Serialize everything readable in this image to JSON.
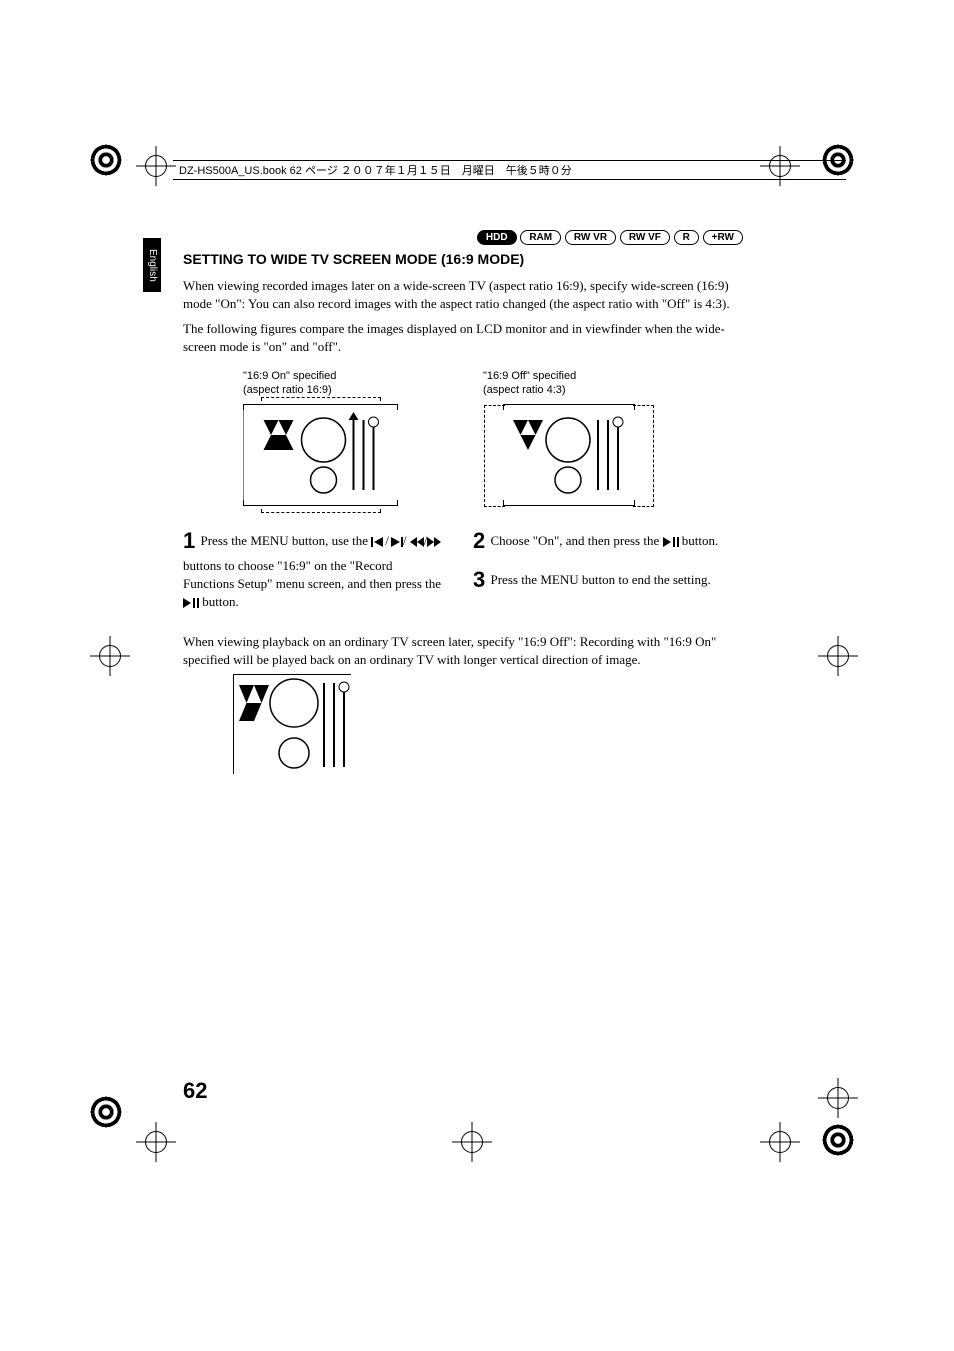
{
  "header_line": "DZ-HS500A_US.book  62 ページ  ２００７年１月１５日　月曜日　午後５時０分",
  "language_tab": "English",
  "badges": [
    "HDD",
    "RAM",
    "RW VR",
    "RW VF",
    "R",
    "+RW"
  ],
  "section_title": "SETTING TO WIDE TV SCREEN MODE (16:9 MODE)",
  "para1": "When viewing recorded images later on a wide-screen TV (aspect ratio 16:9), specify wide-screen (16:9) mode \"On\": You can also record images with the aspect ratio changed (the aspect ratio with \"Off\" is 4:3).",
  "para2": "The following figures compare the images displayed on LCD monitor and in viewfinder when the wide-screen mode is \"on\" and \"off\".",
  "compare": {
    "on_label1": "\"16:9 On\" specified",
    "on_label2": "(aspect ratio 16:9)",
    "off_label1": "\"16:9 Off\" specified",
    "off_label2": "(aspect ratio 4:3)"
  },
  "steps": {
    "s1a": "Press the MENU button, use the ",
    "s1b": " buttons to choose \"16:9\" on the \"Record Functions Setup\" menu screen, and then press the ",
    "s1c": " button.",
    "s2a": "Choose \"On\", and then press the ",
    "s2b": " button.",
    "s3": "Press the MENU button to end the setting."
  },
  "playback_note": "When viewing playback on an ordinary TV screen later, specify \"16:9 Off\": Recording with \"16:9 On\" specified will be played back on an ordinary TV with longer vertical direction of image.",
  "page_number": "62"
}
